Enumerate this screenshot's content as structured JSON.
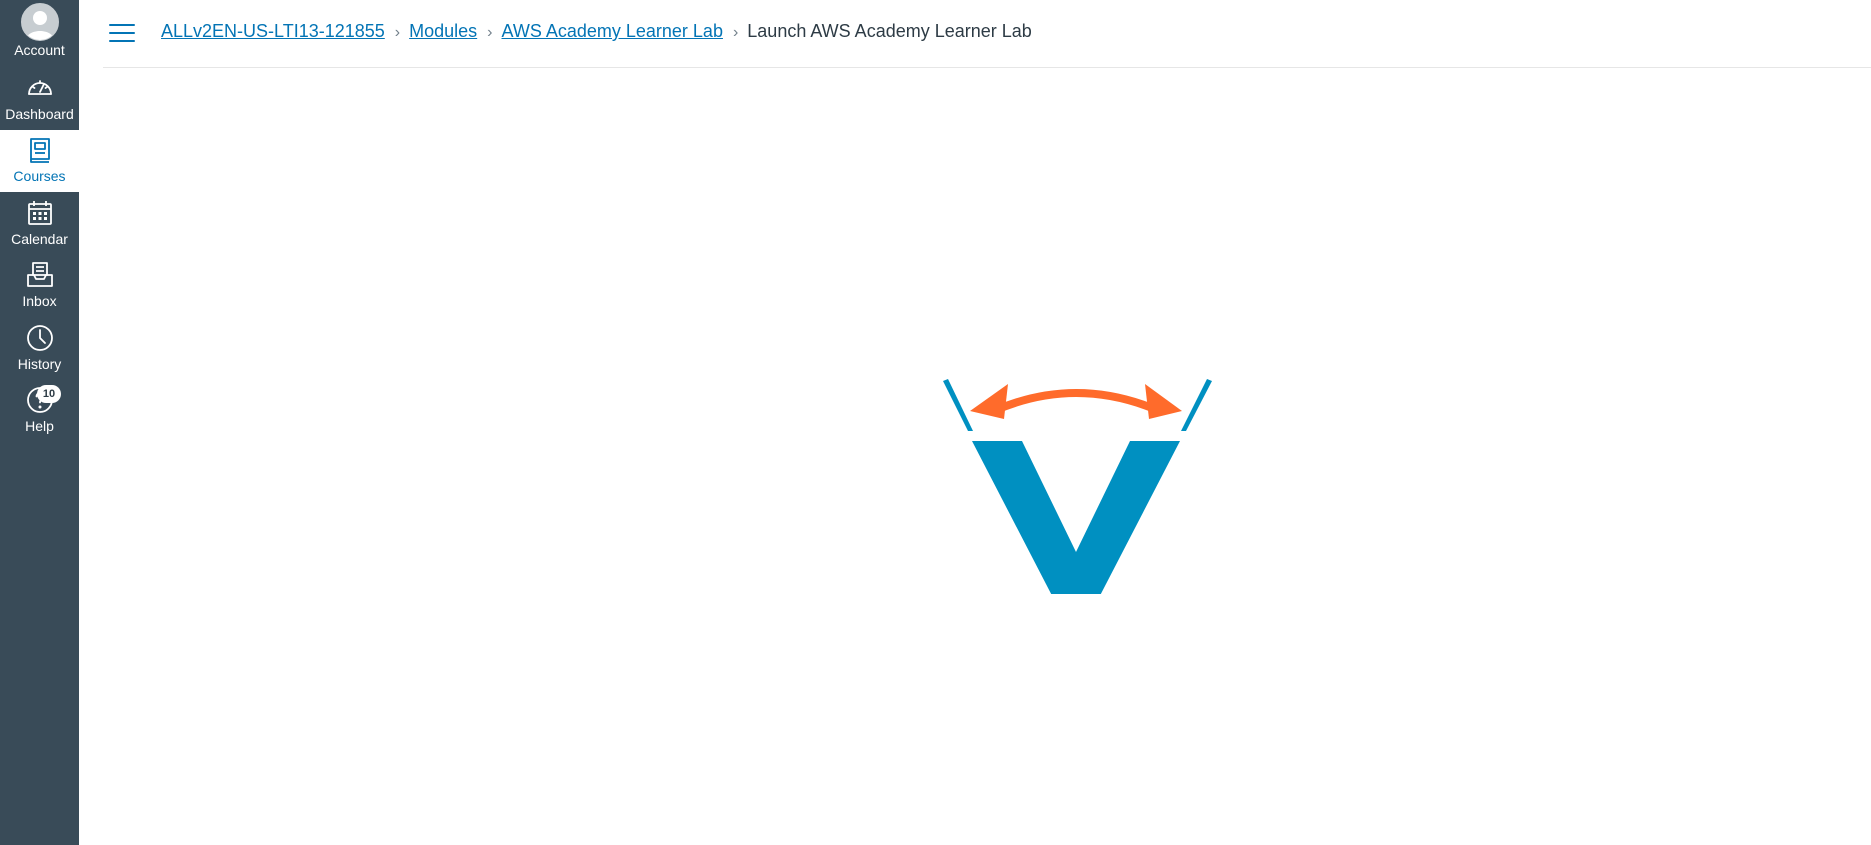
{
  "nav": {
    "account": {
      "label": "Account",
      "icon": "avatar-icon"
    },
    "dashboard": {
      "label": "Dashboard",
      "icon": "dashboard-icon"
    },
    "courses": {
      "label": "Courses",
      "icon": "courses-icon"
    },
    "calendar": {
      "label": "Calendar",
      "icon": "calendar-icon"
    },
    "inbox": {
      "label": "Inbox",
      "icon": "inbox-icon"
    },
    "history": {
      "label": "History",
      "icon": "history-icon"
    },
    "help": {
      "label": "Help",
      "icon": "help-icon",
      "badge": "10"
    }
  },
  "breadcrumb": {
    "items": [
      {
        "label": "ALLv2EN-US-LTI13-121855"
      },
      {
        "label": "Modules"
      },
      {
        "label": "AWS Academy Learner Lab"
      }
    ],
    "current": "Launch AWS Academy Learner Lab"
  },
  "colors": {
    "nav_background": "#394b58",
    "link": "#0374b5",
    "logo_blue": "#0090c1",
    "logo_orange": "#ff6b2b"
  }
}
